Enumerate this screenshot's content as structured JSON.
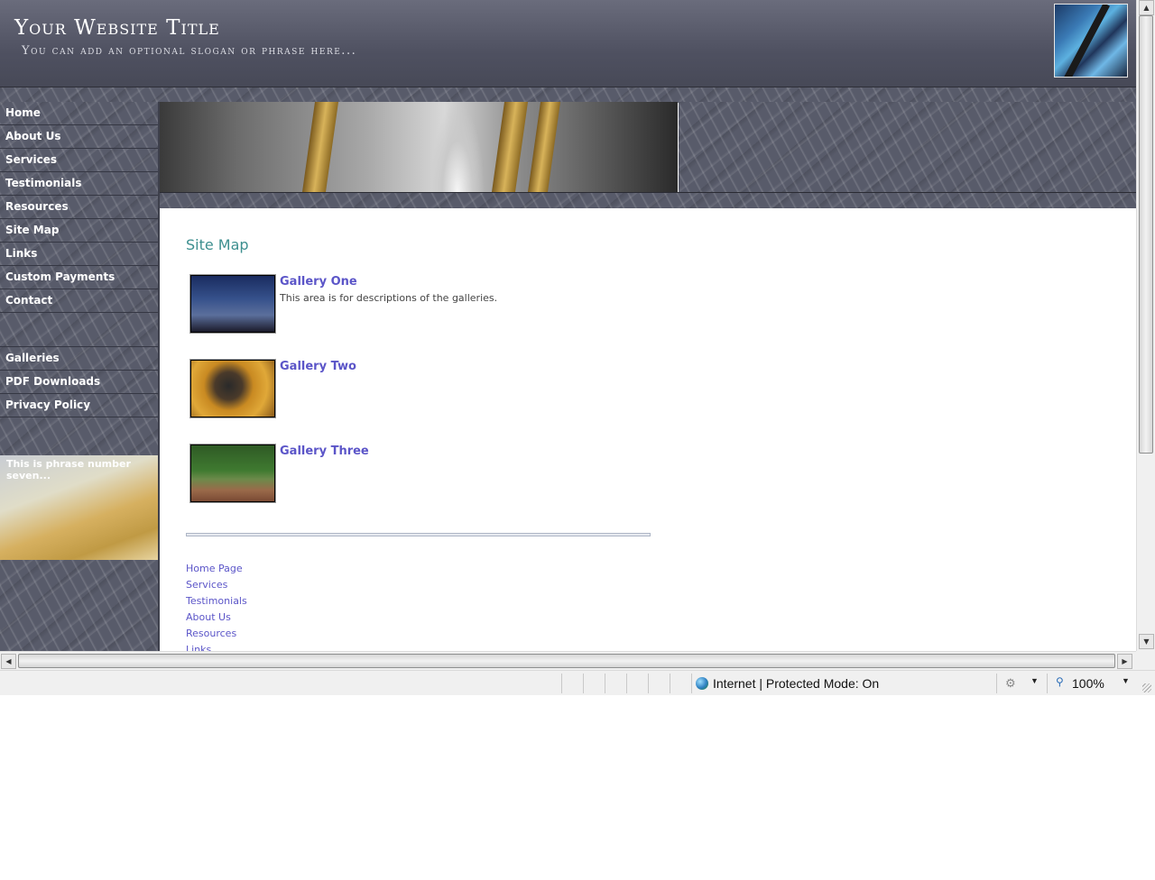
{
  "header": {
    "title": "Your Website Title",
    "slogan": "You can add an optional slogan or phrase here..."
  },
  "sidebar": {
    "nav_primary": [
      "Home",
      "About Us",
      "Services",
      "Testimonials",
      "Resources",
      "Site Map",
      "Links",
      "Custom Payments",
      "Contact"
    ],
    "nav_secondary": [
      "Galleries",
      "PDF Downloads",
      "Privacy Policy"
    ],
    "promo_text": "This is phrase number seven..."
  },
  "main": {
    "heading": "Site Map",
    "galleries": [
      {
        "title": "Gallery One",
        "description": "This area is for descriptions of the galleries."
      },
      {
        "title": "Gallery Two",
        "description": ""
      },
      {
        "title": "Gallery Three",
        "description": ""
      }
    ],
    "footer_links": [
      "Home Page",
      "Services",
      "Testimonials",
      "About Us",
      "Resources",
      "Links"
    ]
  },
  "statusbar": {
    "zone": "Internet | Protected Mode: On",
    "zoom": "100%"
  },
  "colors": {
    "link": "#5b55c8",
    "heading": "#3d8f8f",
    "header_bg": "#4f5161"
  }
}
